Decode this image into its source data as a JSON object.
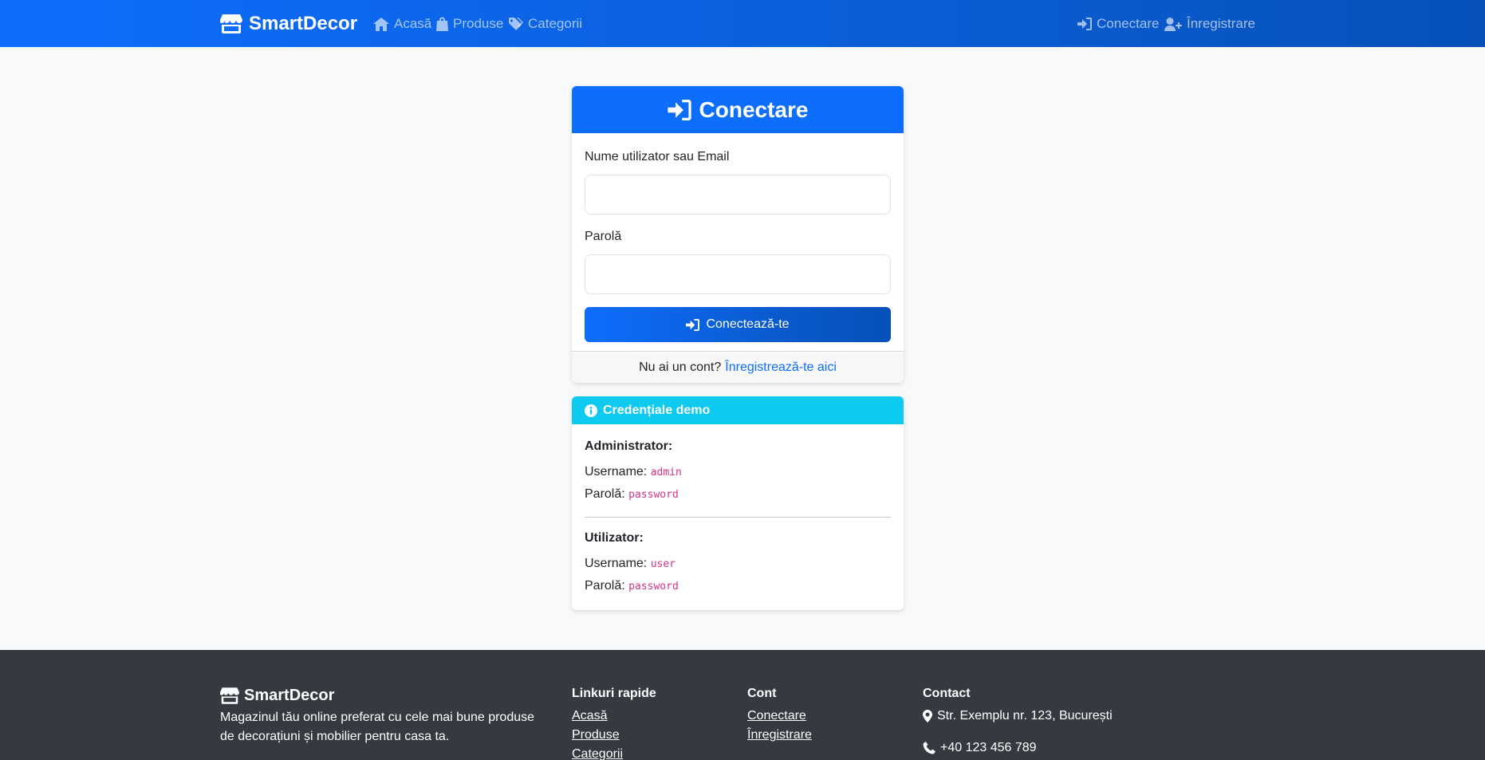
{
  "navbar": {
    "brand": "SmartDecor",
    "links": [
      {
        "label": "Acasă",
        "icon": "home-icon"
      },
      {
        "label": "Produse",
        "icon": "shopping-bag-icon"
      },
      {
        "label": "Categorii",
        "icon": "tags-icon"
      }
    ],
    "right_links": [
      {
        "label": "Conectare",
        "icon": "sign-in-icon"
      },
      {
        "label": "Înregistrare",
        "icon": "user-plus-icon"
      }
    ]
  },
  "login": {
    "title": "Conectare",
    "username_label": "Nume utilizator sau Email",
    "username_value": "",
    "password_label": "Parolă",
    "password_value": "",
    "submit_label": "Conectează-te",
    "footer_text": "Nu ai un cont?",
    "footer_link": "Înregistrează-te aici"
  },
  "demo": {
    "title": "Credențiale demo",
    "admin": {
      "heading": "Administrator:",
      "username_label": "Username:",
      "username": "admin",
      "password_label": "Parolă:",
      "password": "password"
    },
    "user": {
      "heading": "Utilizator:",
      "username_label": "Username:",
      "username": "user",
      "password_label": "Parolă:",
      "password": "password"
    }
  },
  "footer": {
    "brand": "SmartDecor",
    "description": "Magazinul tău online preferat cu cele mai bune produse de decorațiuni și mobilier pentru casa ta.",
    "quick_links": {
      "heading": "Linkuri rapide",
      "items": [
        "Acasă",
        "Produse",
        "Categorii"
      ]
    },
    "account": {
      "heading": "Cont",
      "items": [
        "Conectare",
        "Înregistrare"
      ]
    },
    "contact": {
      "heading": "Contact",
      "address": "Str. Exemplu nr. 123, București",
      "phone": "+40 123 456 789"
    }
  },
  "colors": {
    "primary": "#0d6efd",
    "info": "#0dcaf0",
    "footer_bg": "#343a40",
    "page_bg": "#f8f9fa",
    "code": "#d63384"
  }
}
